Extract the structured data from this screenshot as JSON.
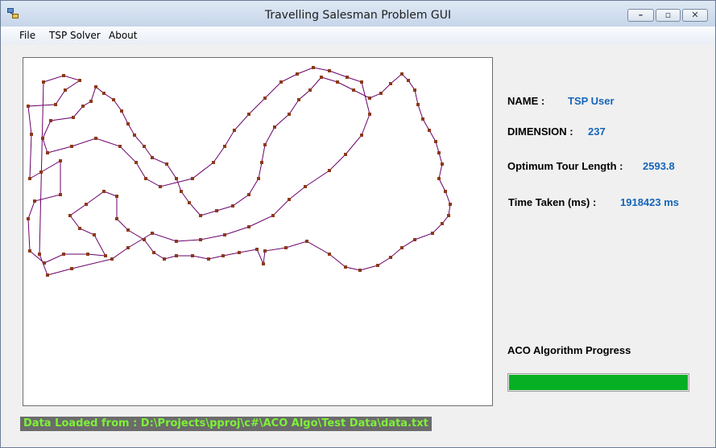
{
  "window": {
    "title": "Travelling Salesman Problem GUI",
    "icons": {
      "app": "app-icon",
      "minimize": "minimize-icon",
      "maximize": "maximize-icon",
      "close": "close-icon"
    }
  },
  "menu": {
    "items": [
      {
        "label": "File"
      },
      {
        "label": "TSP Solver"
      },
      {
        "label": "About"
      }
    ]
  },
  "info": {
    "name_label": "NAME :",
    "name_value": "TSP User",
    "dimension_label": "DIMENSION :",
    "dimension_value": "237",
    "tour_label": "Optimum Tour Length :",
    "tour_value": "2593.8",
    "time_label": "Time Taken (ms) :",
    "time_value": "1918423 ms"
  },
  "progress": {
    "label": "ACO Algorithm Progress",
    "percent": 100
  },
  "status": {
    "text": "Data Loaded from : D:\\Projects\\pproj\\c#\\ACO Algo\\Test Data\\data.txt"
  },
  "colors": {
    "route": "#6a006a",
    "city": "#8b3a1a",
    "value_text": "#1565b8",
    "progress_fill": "#06b025",
    "status_bg": "#6b6b6b",
    "status_text": "#7df238"
  }
}
